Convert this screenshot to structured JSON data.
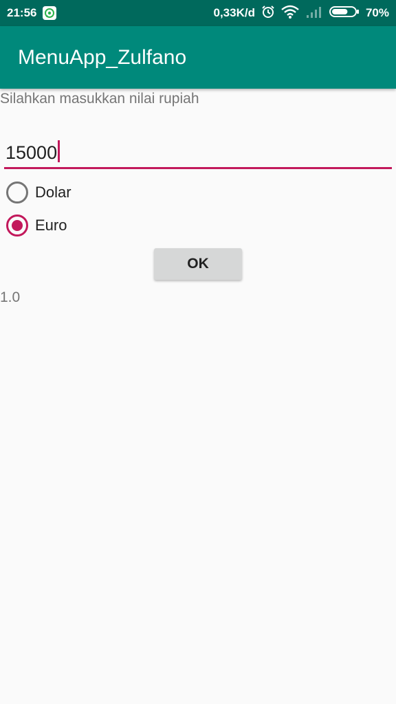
{
  "status_bar": {
    "time": "21:56",
    "network_speed": "0,33K/d",
    "battery_percent": "70%",
    "battery_level": 0.7,
    "icons": [
      "whatsapp-icon",
      "alarm-icon",
      "wifi-icon",
      "signal-icon",
      "battery-icon"
    ]
  },
  "app_bar": {
    "title": "MenuApp_Zulfano"
  },
  "form": {
    "prompt": "Silahkan masukkan nilai rupiah",
    "amount_value": "15000",
    "options": [
      {
        "label": "Dolar",
        "checked": false
      },
      {
        "label": "Euro",
        "checked": true
      }
    ],
    "ok_label": "OK"
  },
  "result": {
    "value": "1.0"
  },
  "colors": {
    "status_bar": "#00695c",
    "app_bar": "#00897b",
    "accent": "#c2185b",
    "background": "#fafafa"
  }
}
